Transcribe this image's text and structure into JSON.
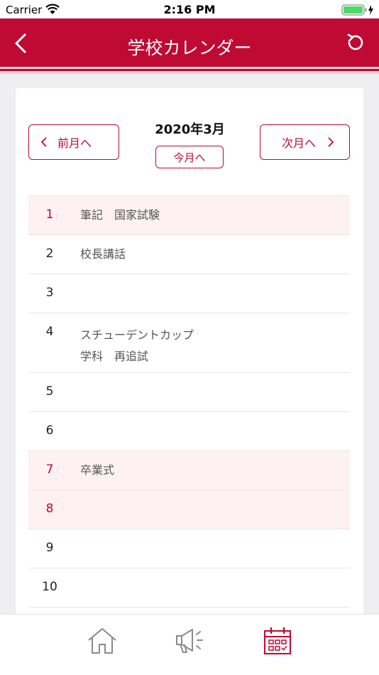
{
  "status": {
    "carrier": "Carrier",
    "time": "2:16 PM"
  },
  "header": {
    "title": "学校カレンダー",
    "back_icon": "chevron-left-icon",
    "refresh_icon": "refresh-icon"
  },
  "calendar": {
    "month_label": "2020年3月",
    "prev_label": "前月へ",
    "next_label": "次月へ",
    "today_label": "今月へ",
    "days": [
      {
        "day": "1",
        "events": [
          "筆記　国家試験"
        ],
        "highlight": true
      },
      {
        "day": "2",
        "events": [
          "校長講話"
        ],
        "highlight": false
      },
      {
        "day": "3",
        "events": [],
        "highlight": false
      },
      {
        "day": "4",
        "events": [
          "スチューデントカップ",
          "学科　再追試"
        ],
        "highlight": false
      },
      {
        "day": "5",
        "events": [],
        "highlight": false
      },
      {
        "day": "6",
        "events": [],
        "highlight": false
      },
      {
        "day": "7",
        "events": [
          "卒業式"
        ],
        "highlight": true
      },
      {
        "day": "8",
        "events": [],
        "highlight": true
      },
      {
        "day": "9",
        "events": [],
        "highlight": false
      },
      {
        "day": "10",
        "events": [],
        "highlight": false
      }
    ]
  },
  "tabs": [
    {
      "name": "home",
      "icon": "home-icon",
      "active": false
    },
    {
      "name": "news",
      "icon": "megaphone-icon",
      "active": false
    },
    {
      "name": "calendar",
      "icon": "calendar-icon",
      "active": true
    }
  ],
  "colors": {
    "brand": "#bf0a34",
    "highlight_row": "#fdf1f3",
    "inactive_icon": "#8a8a8a"
  }
}
